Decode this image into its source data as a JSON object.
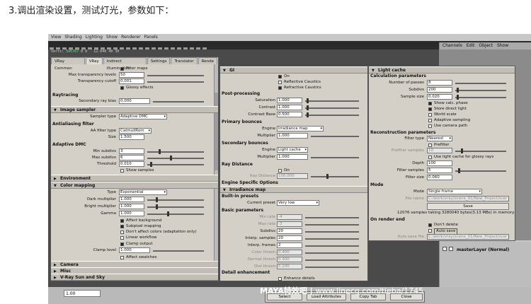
{
  "heading": "3.调出渲染设置，测试灯光，参数如下：",
  "maya": {
    "menu": [
      "View",
      "Shading",
      "Lighting",
      "Show",
      "Renderer",
      "Panels"
    ],
    "stats": {
      "verts_label": "Verts:",
      "verts": "545767",
      "v0": "0",
      "v1": "0",
      "faces": "12.040",
      "f0": "40",
      "f1": "30",
      "edges": "12.040",
      "e0": "40",
      "e1": "30"
    },
    "time_value": "1.00",
    "channel_menu": [
      "Channels",
      "Edit",
      "Object",
      "Show"
    ],
    "layer_name": "masterLayer (Normal)"
  },
  "watermark": {
    "brand": "MAYA特效吧",
    "sep": "|",
    "url": "www.linecg.com/tieba/1745"
  },
  "panel1": {
    "tabs": [
      "VRay Common",
      "VRay",
      "Indirect Illumination",
      "Settings",
      "Translator",
      "Rende"
    ],
    "filter_maps": "Filter maps",
    "max_transp_label": "Max transparency levels",
    "max_transp": "50",
    "transp_cutoff_label": "Transparency cutoff",
    "transp_cutoff": "0.001",
    "glossy_label": "Glossy effects",
    "raytracing": "Raytracing",
    "ray_bias_label": "Secondary ray bias",
    "ray_bias": "0.000",
    "image_sampler": "Image sampler",
    "sampler_type_label": "Sampler type",
    "sampler_type": "Adaptive DMC",
    "aa_filter": "Antialiasing filter",
    "aa_filter_type_label": "AA filter type",
    "aa_filter_type": "CatmullRom",
    "size_label": "Size",
    "size": "1.500",
    "adaptive_dmc": "Adaptive DMC",
    "min_subdivs_label": "Min subdivs",
    "min_subdivs": "3",
    "max_subdivs_label": "Max subdivs",
    "max_subdivs": "6",
    "threshold_label": "Threshold",
    "threshold": "0.010",
    "show_samples": "Show samples",
    "environment": "Environment",
    "color_mapping": "Color mapping",
    "cm_type_label": "Type",
    "cm_type": "Exponential",
    "dark_mult_label": "Dark multiplier",
    "dark_mult": "1.000",
    "bright_mult_label": "Bright multiplier",
    "bright_mult": "1.000",
    "gamma_label": "Gamma",
    "gamma": "1.000",
    "affect_bg": "Affect background",
    "subpixel": "Subpixel mapping",
    "dont_affect": "Don't affect colors (adaptation only)",
    "linear_wf": "Linear workflow",
    "clamp_output": "Clamp output",
    "clamp_level_label": "Clamp level",
    "clamp_level": "1.000",
    "affect_swatches": "Affect swatches",
    "camera": "Camera",
    "misc": "Misc",
    "sun_sky": "V-Ray Sun and Sky"
  },
  "panel2": {
    "gi": "GI",
    "on": "On",
    "refl_caustics": "Reflective Caustics",
    "refr_caustics": "Refractive Caustics",
    "post_processing": "Post-processing",
    "saturation_label": "Saturation",
    "saturation": "1.000",
    "contrast_label": "Contrast",
    "contrast": "1.000",
    "contrast_base_label": "Contrast Base",
    "contrast_base": "0.500",
    "primary_bounces": "Primary bounces",
    "engine_label": "Engine",
    "primary_engine": "Irradiance map",
    "multiplier_label": "Multiplier",
    "primary_mult": "1.000",
    "secondary_bounces": "Secondary bounces",
    "secondary_engine": "Light cache",
    "secondary_mult": "1.000",
    "ray_distance": "Ray Distance",
    "rd_on": "On",
    "rd_label": "Ray Distance",
    "rd_value": "100.000",
    "engine_specific": "Engine Specific Options",
    "irradiance_map": "Irradiance map",
    "builtin_presets": "Built-in presets",
    "current_preset_label": "Current preset",
    "current_preset": "Very low",
    "basic_params": "Basic parameters",
    "min_rate_label": "Min rate",
    "min_rate": "-4",
    "max_rate_label": "Max rate",
    "max_rate": "-3",
    "subdivs_label": "Subdivs",
    "subdivs": "20",
    "interp_samples_label": "Interp. samples",
    "interp_samples": "20",
    "interp_frames_label": "Interp. frames",
    "interp_frames": "2",
    "color_thresh_label": "Color thresh",
    "color_thresh": "0.400",
    "normal_thresh_label": "Normal thresh",
    "normal_thresh": "0.300",
    "dist_thresh_label": "Dist thresh",
    "dist_thresh": "0.100",
    "detail_enh": "Detail enhancement",
    "enhance_details": "Enhance details"
  },
  "panel3": {
    "light_cache": "Light cache",
    "calc_params": "Calculation parameters",
    "passes_label": "Number of passes",
    "passes": "8",
    "subdivs_label": "Subdivs",
    "subdivs": "200",
    "sample_size_label": "Sample size",
    "sample_size": "0.020",
    "show_calc": "Show calc. phase",
    "store_direct": "Store direct light",
    "world_scale": "World scale",
    "adaptive_sampling": "Adaptive sampling",
    "use_camera_path": "Use camera path",
    "recon_params": "Reconstruction parameters",
    "filter_type_label": "Filter type",
    "filter_type": "Nearest",
    "prefilter": "Prefilter",
    "prefilter_samples_label": "Prefilter samples",
    "prefilter_samples": "10",
    "use_lc_glossy": "Use light cache for glossy rays",
    "depth_label": "Depth",
    "depth": "100",
    "filter_samples_label": "Filter samples",
    "filter_samples": "5",
    "filter_size_label": "Filter size",
    "filter_size": "0.060",
    "mode": "Mode",
    "mode_label": "Mode",
    "mode_value": "Single frame",
    "file_name_label": "File name",
    "file_name": "C:/work/vray/scene_01/New_Project/scer",
    "save_btn": "Save",
    "samples_info": "12076 samples taking 3280040 bytes(3.13 MBs) in memory",
    "on_render_end": "On render end",
    "dont_delete": "Don't delete",
    "auto_save": "Auto save",
    "auto_save_file_label": "Auto save file",
    "auto_save_file": "C:/work/vray/scene_01/New_Project/scer"
  },
  "buttons": {
    "select": "Select",
    "load_attr": "Load Attributes",
    "copy_tab": "Copy Tab",
    "close": "Close"
  }
}
